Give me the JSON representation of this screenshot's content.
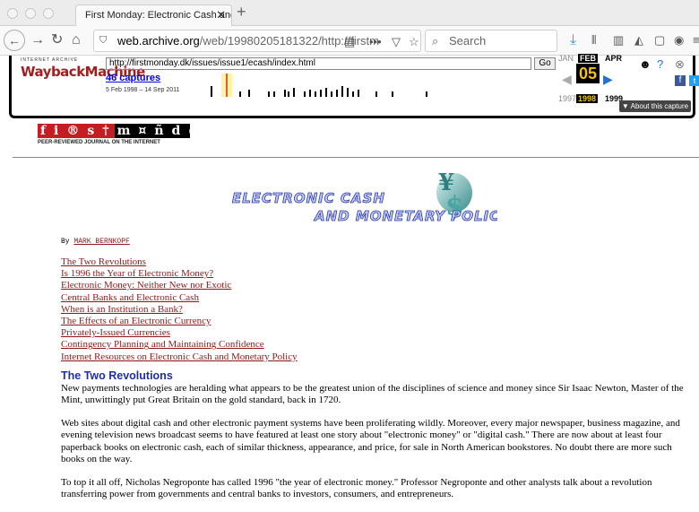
{
  "browser": {
    "tab_title": "First Monday: Electronic Cash and M",
    "url_domain": "web.archive.org",
    "url_rest": "/web/19980205181322/http://firstm",
    "search_placeholder": "Search"
  },
  "wayback": {
    "logo_small": "INTERNET ARCHIVE",
    "logo": "WaybackMachine",
    "url": "http://firstmonday.dk/issues/issue1/ecash/index.html",
    "go_label": "Go",
    "captures": "46 captures",
    "range": "5 Feb 1998 – 14 Sep 2011",
    "month_prev": "JAN",
    "month_cur": "FEB",
    "month_next": "APR",
    "day": "05",
    "year_prev": "1997",
    "year_cur": "1998",
    "year_next": "1999",
    "about": "▼ About this capture"
  },
  "site": {
    "logo_letters": [
      "f",
      "i",
      "®",
      "s",
      "†",
      "m",
      "¤",
      "ñ",
      "d",
      "@",
      "¥"
    ],
    "tagline": "PEER-REVIEWED JOURNAL ON THE INTERNET"
  },
  "article": {
    "title_line1": "ELECTRONIC CASH",
    "title_line2": "AND MONETARY POLICY",
    "by_label": "By ",
    "author": "MARK BERNKOPF",
    "toc": [
      "The Two Revolutions",
      "Is 1996 the Year of Electronic Money?",
      "Electronic Money: Neither New nor Exotic",
      "Central Banks and Electronic Cash",
      "When is an Institution a Bank?",
      "The Effects of an Electronic Currency",
      "Privately-Issued Currencies",
      "Contingency Planning and Maintaining Confidence",
      "Internet Resources on Electronic Cash and Monetary Policy"
    ],
    "section_heading": "The Two Revolutions",
    "paragraphs": [
      "New payments technologies are heralding what appears to be the greatest union of the disciplines of science and money since Sir Isaac Newton, Master of the Mint, unwittingly put Great Britain on the gold standard, back in 1720.",
      "Web sites about digital cash and other electronic payment systems have been proliferating wildly. Moreover, every major newspaper, business magazine, and evening television news broadcast seems to have featured at least one story about \"electronic money\" or \"digital cash.\" There are now about at least four paperback books on electronic cash, each of similar thickness, appearance, and price, for sale in North American bookstores. No doubt there are more such books on the way.",
      "To top it all off, Nicholas Negroponte has called 1996 \"the year of electronic money.\" Professor Negroponte and other analysts talk about a revolution transferring power from governments and central banks to investors, consumers, and entrepreneurs."
    ]
  }
}
